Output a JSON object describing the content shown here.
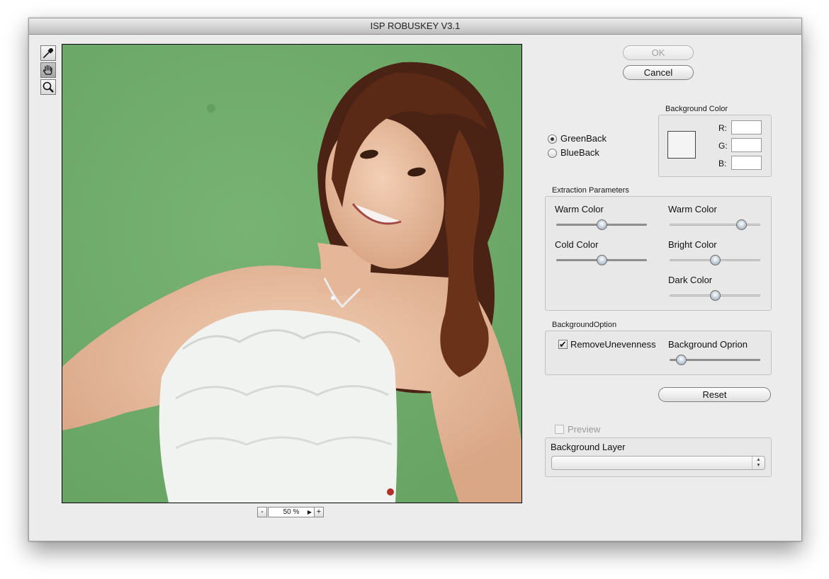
{
  "window": {
    "title": "ISP ROBUSKEY V3.1"
  },
  "tools": [
    {
      "name": "eyedropper-tool",
      "icon": "eyedropper-icon"
    },
    {
      "name": "hand-tool",
      "icon": "hand-icon",
      "active": true
    },
    {
      "name": "zoom-tool",
      "icon": "magnifier-icon"
    }
  ],
  "preview": {
    "zoom_value": "50 %",
    "zoom_out_label": "-",
    "zoom_in_label": "+"
  },
  "buttons": {
    "ok_label": "OK",
    "cancel_label": "Cancel",
    "reset_label": "Reset"
  },
  "back_mode": {
    "options": [
      "GreenBack",
      "BlueBack"
    ],
    "selected": "GreenBack"
  },
  "background_color": {
    "title": "Background Color",
    "r_label": "R:",
    "g_label": "G:",
    "b_label": "B:",
    "r": "",
    "g": "",
    "b": ""
  },
  "extraction": {
    "title": "Extraction Parameters",
    "sliders": [
      {
        "label": "Warm Color",
        "value": 0.5
      },
      {
        "label": "Warm Color",
        "value": 0.83
      },
      {
        "label": "Cold Color",
        "value": 0.5
      },
      {
        "label": "Bright Color",
        "value": 0.5
      },
      {
        "label": "Dark Color",
        "value": 0.5
      }
    ]
  },
  "background_option": {
    "title": "BackgroundOption",
    "remove_unevenness_label": "RemoveUnevenness",
    "remove_unevenness_checked": true,
    "option_label": "Background Oprion",
    "option_value": 0.08
  },
  "preview_checkbox": {
    "label": "Preview",
    "checked": false,
    "enabled": false
  },
  "background_layer": {
    "label": "Background Layer",
    "value": ""
  },
  "colors": {
    "canvas_green": "#71ad6c",
    "window_bg": "#ececec"
  }
}
